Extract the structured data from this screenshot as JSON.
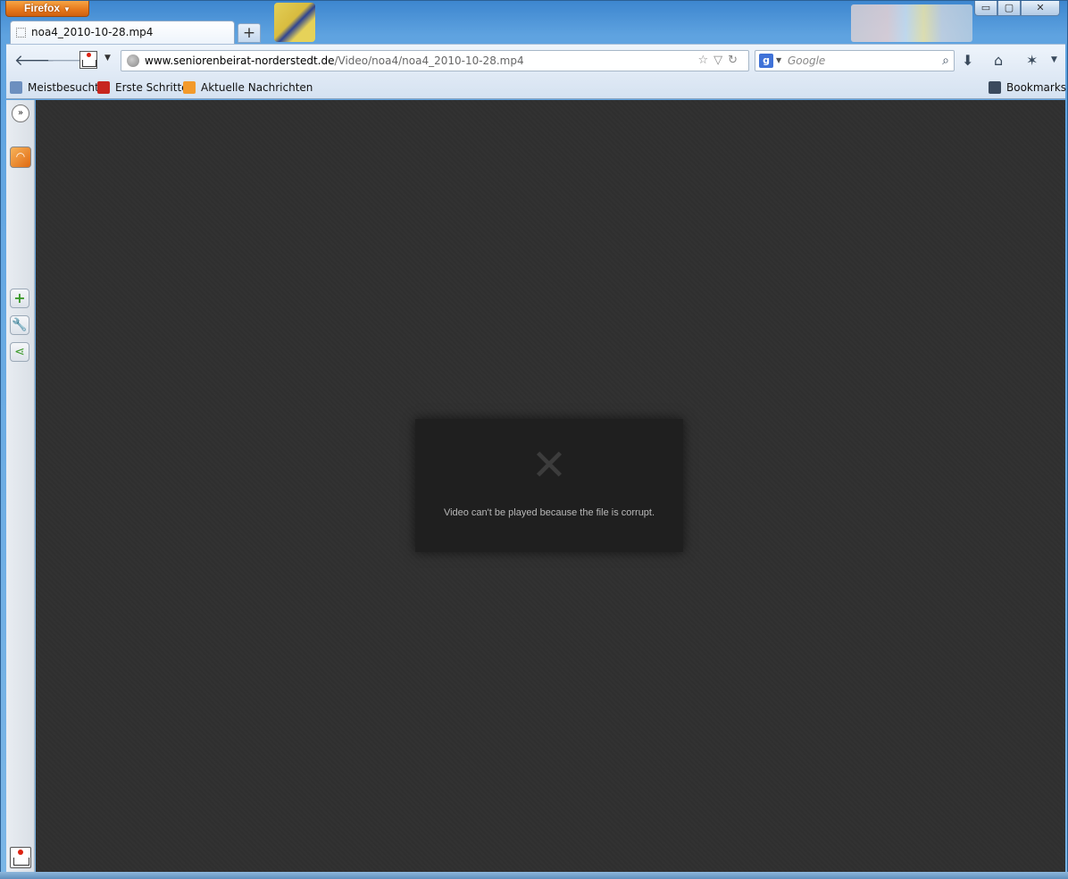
{
  "window": {
    "app_button": "Firefox",
    "controls": {
      "minimize": "▭",
      "maximize": "▢",
      "close": "✕"
    }
  },
  "tabs": [
    {
      "label": "noa4_2010-10-28.mp4"
    }
  ],
  "new_tab_label": "+",
  "navbar": {
    "url_host": "www.seniorenbeirat-norderstedt.de",
    "url_path": "/Video/noa4/noa4_2010-10-28.mp4",
    "search_placeholder": "Google",
    "search_engine_glyph": "g"
  },
  "bookmarks": {
    "items": [
      {
        "label": "Meistbesucht",
        "icon": "most-visited-icon"
      },
      {
        "label": "Erste Schritte",
        "icon": "firefox-icon"
      },
      {
        "label": "Aktuelle Nachrichten",
        "icon": "rss-icon"
      }
    ],
    "bookmarks_menu": "Bookmarks"
  },
  "content": {
    "error_glyph": "✕",
    "error_message": "Video can't be played because the file is corrupt."
  },
  "colors": {
    "content_bg": "#303030",
    "error_box_bg": "#1f1f1f",
    "firefox_orange": "#e5771b"
  }
}
